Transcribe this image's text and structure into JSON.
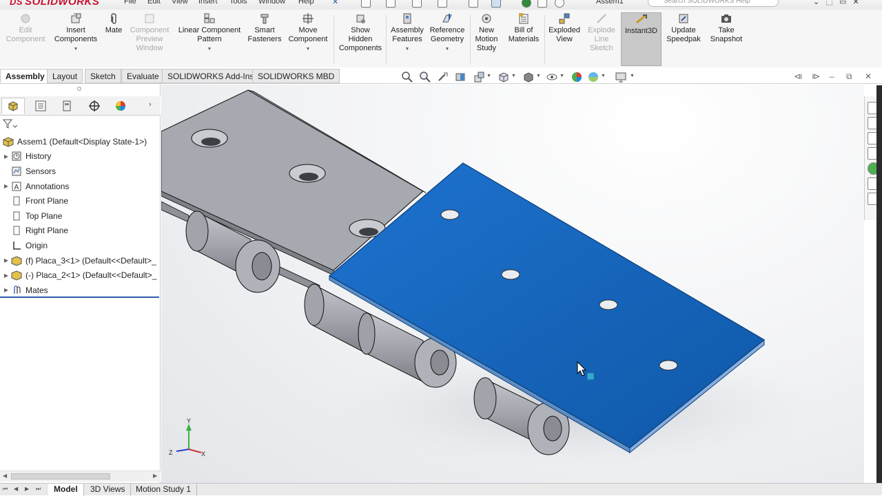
{
  "app": {
    "logo_text": "SOLIDWORKS",
    "logo_prefix": "DS",
    "doc_title": "Assem1",
    "search_placeholder": "Search SOLIDWORKS Help"
  },
  "menu": [
    "File",
    "Edit",
    "View",
    "Insert",
    "Tools",
    "Window",
    "Help"
  ],
  "toolbar": {
    "edit_component": "Edit\nComponent",
    "insert_components": "Insert\nComponents",
    "mate": "Mate",
    "component_preview": "Component\nPreview\nWindow",
    "linear_pattern": "Linear Component\nPattern",
    "smart_fasteners": "Smart\nFasteners",
    "move_component": "Move\nComponent",
    "show_hidden": "Show\nHidden\nComponents",
    "assembly_features": "Assembly\nFeatures",
    "reference_geometry": "Reference\nGeometry",
    "new_motion_study": "New\nMotion\nStudy",
    "bill_of_materials": "Bill of\nMaterials",
    "exploded_view": "Exploded\nView",
    "explode_line_sketch": "Explode\nLine\nSketch",
    "instant3d": "Instant3D",
    "update_speedpak": "Update\nSpeedpak",
    "take_snapshot": "Take\nSnapshot"
  },
  "tabs": [
    "Assembly",
    "Layout",
    "Sketch",
    "Evaluate",
    "SOLIDWORKS Add-Ins",
    "SOLIDWORKS MBD"
  ],
  "tree": {
    "root": "Assem1  (Default<Display State-1>)",
    "items": [
      "History",
      "Sensors",
      "Annotations",
      "Front Plane",
      "Top Plane",
      "Right Plane",
      "Origin",
      "(f) Placa_3<1> (Default<<Default>_",
      "(-) Placa_2<1> (Default<<Default>_",
      "Mates"
    ]
  },
  "bottom_tabs": [
    "Model",
    "3D Views",
    "Motion Study 1"
  ],
  "triad": {
    "x": "X",
    "y": "Y",
    "z": "Z"
  },
  "colors": {
    "selected_part": "#1565c0",
    "grey_part": "#a4a6ad",
    "accent_red": "#c8102e",
    "tree_divider": "#2a5caa"
  }
}
